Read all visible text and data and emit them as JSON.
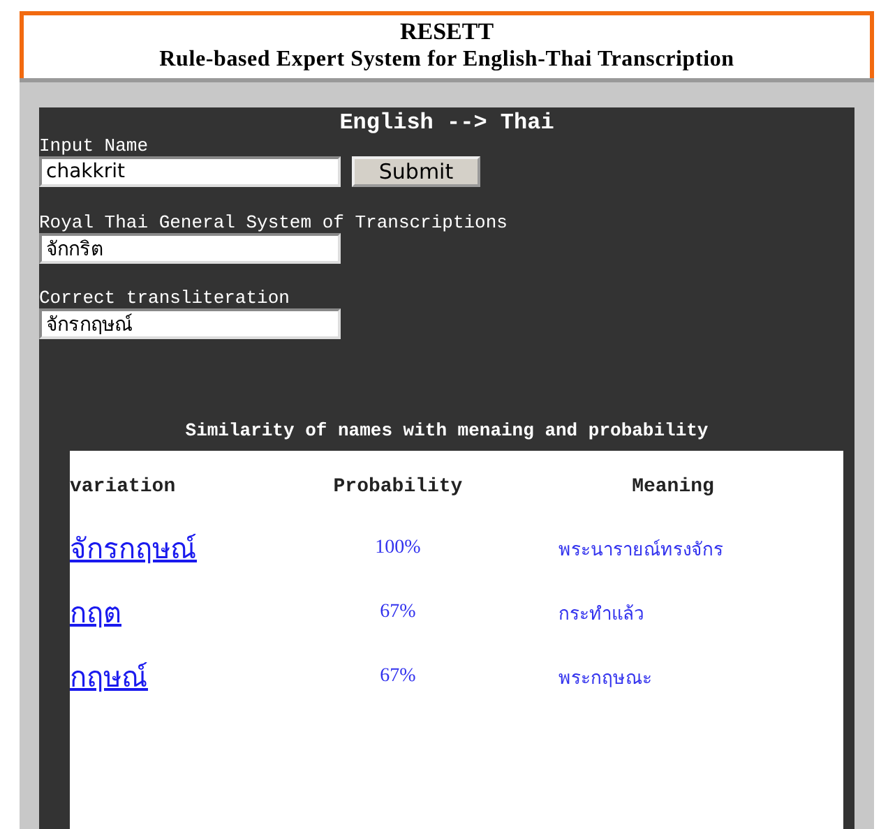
{
  "header": {
    "title": "RESETT",
    "subtitle": "Rule-based Expert System for English-Thai Transcription"
  },
  "panel": {
    "title": "English --> Thai",
    "input": {
      "label": "Input Name",
      "value": "chakkrit",
      "button": "Submit"
    },
    "fields": [
      {
        "label": "Royal Thai General System of Transcriptions",
        "value": "จักกริต"
      },
      {
        "label": "Correct transliteration",
        "value": "จักรกฤษณ์"
      }
    ],
    "similarity": {
      "title": "Similarity of names with menaing and probability",
      "columns": [
        "variation",
        "Probability",
        "Meaning"
      ],
      "rows": [
        {
          "variation": "จักรกฤษณ์",
          "probability": "100%",
          "meaning": "พระนารายณ์ทรงจักร"
        },
        {
          "variation": "กฤต",
          "probability": "67%",
          "meaning": "กระทำแล้ว"
        },
        {
          "variation": "กฤษณ์",
          "probability": "67%",
          "meaning": "พระกฤษณะ"
        }
      ]
    }
  }
}
